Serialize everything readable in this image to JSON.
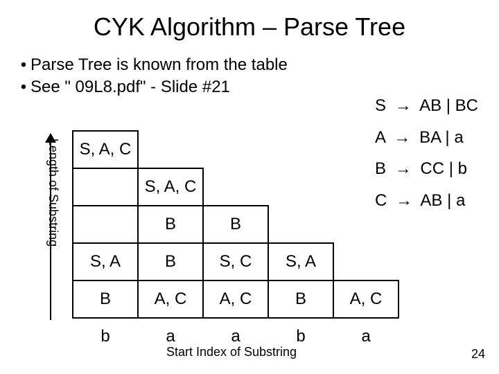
{
  "title": "CYK Algorithm – Parse Tree",
  "bullets": [
    "Parse Tree is known from the table",
    "See \" 09L8.pdf\" - Slide #21"
  ],
  "grammar": [
    {
      "lhs": "S",
      "rhs": "AB | BC"
    },
    {
      "lhs": "A",
      "rhs": "BA | a"
    },
    {
      "lhs": "B",
      "rhs": "CC | b"
    },
    {
      "lhs": "C",
      "rhs": "AB | a"
    }
  ],
  "arrow_glyph": "→",
  "axes": {
    "y": "Length of Substring",
    "x": "Start Index of Substring"
  },
  "table": {
    "rows": [
      [
        "S, A, C",
        "",
        "",
        "",
        ""
      ],
      [
        "",
        "S, A, C",
        "",
        "",
        ""
      ],
      [
        "",
        "B",
        "B",
        "",
        ""
      ],
      [
        "S, A",
        "B",
        "S, C",
        "S, A",
        ""
      ],
      [
        "B",
        "A, C",
        "A, C",
        "B",
        "A, C"
      ]
    ],
    "input": [
      "b",
      "a",
      "a",
      "b",
      "a"
    ]
  },
  "page_number": "24"
}
